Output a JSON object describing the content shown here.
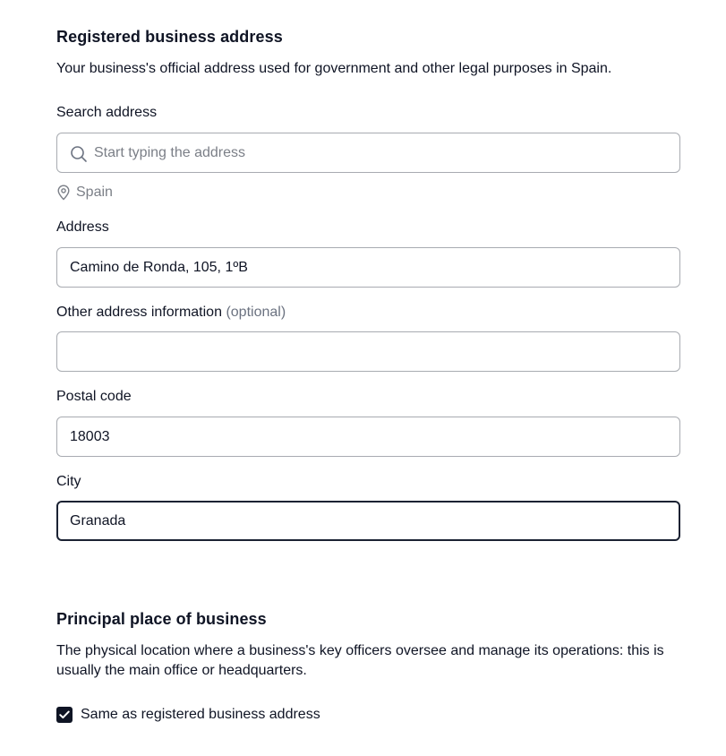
{
  "registered": {
    "title": "Registered business address",
    "description": "Your business's official address used for government and other legal purposes in Spain.",
    "search": {
      "label": "Search address",
      "placeholder": "Start typing the address",
      "value": "",
      "country": "Spain"
    },
    "address": {
      "label": "Address",
      "value": "Camino de Ronda, 105, 1ºB"
    },
    "other": {
      "label": "Other address information",
      "optional": "(optional)",
      "value": ""
    },
    "postal": {
      "label": "Postal code",
      "value": "18003"
    },
    "city": {
      "label": "City",
      "value": "Granada"
    }
  },
  "principal": {
    "title": "Principal place of business",
    "description": "The physical location where a business's key officers oversee and manage its operations: this is usually the main office or headquarters.",
    "same_as_label": "Same as registered business address",
    "same_as_checked": true
  }
}
